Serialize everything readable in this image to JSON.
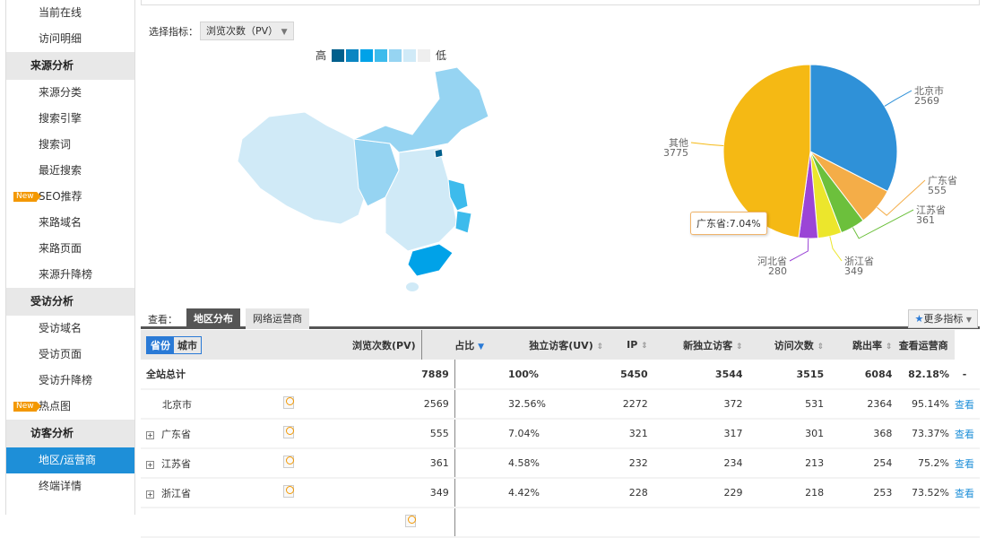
{
  "sidebar": {
    "items": [
      {
        "type": "item",
        "label": "当前在线"
      },
      {
        "type": "item",
        "label": "访问明细"
      },
      {
        "type": "head",
        "label": "来源分析"
      },
      {
        "type": "item",
        "label": "来源分类"
      },
      {
        "type": "item",
        "label": "搜索引擎"
      },
      {
        "type": "item",
        "label": "搜索词"
      },
      {
        "type": "item",
        "label": "最近搜索"
      },
      {
        "type": "item",
        "label": "SEO推荐",
        "badge": "New"
      },
      {
        "type": "item",
        "label": "来路域名"
      },
      {
        "type": "item",
        "label": "来路页面"
      },
      {
        "type": "item",
        "label": "来源升降榜"
      },
      {
        "type": "head",
        "label": "受访分析"
      },
      {
        "type": "item",
        "label": "受访域名"
      },
      {
        "type": "item",
        "label": "受访页面"
      },
      {
        "type": "item",
        "label": "受访升降榜"
      },
      {
        "type": "item",
        "label": "热点图",
        "badge": "New"
      },
      {
        "type": "head",
        "label": "访客分析"
      },
      {
        "type": "item",
        "label": "地区/运营商",
        "active": true
      },
      {
        "type": "item",
        "label": "终端详情"
      }
    ]
  },
  "metric": {
    "label": "选择指标：",
    "value": "浏览次数（PV）"
  },
  "legend": {
    "high": "高",
    "low": "低",
    "colors": [
      "#005f8c",
      "#0a86c2",
      "#00a2e8",
      "#3dbbec",
      "#96d4f2",
      "#d0eaf7",
      "#eeeeee"
    ]
  },
  "chart_data": {
    "type": "pie",
    "title": "",
    "slices": [
      {
        "name": "北京市",
        "value": 2569,
        "color": "#2f91d8"
      },
      {
        "name": "广东省",
        "value": 555,
        "color": "#f4ad48"
      },
      {
        "name": "江苏省",
        "value": 361,
        "color": "#6cc03c"
      },
      {
        "name": "浙江省",
        "value": 349,
        "color": "#ece62c"
      },
      {
        "name": "河北省",
        "value": 280,
        "color": "#9b45d6"
      },
      {
        "name": "其他",
        "value": 3775,
        "color": "#f5b914"
      }
    ],
    "tooltip": "广东省:7.04%"
  },
  "tabs": {
    "label": "查看：",
    "items": [
      "地区分布",
      "网络运营商"
    ],
    "more": "更多指标"
  },
  "table": {
    "toggle": [
      "省份",
      "城市"
    ],
    "headers": [
      "浏览次数(PV)",
      "占比",
      "独立访客(UV)",
      "IP",
      "新独立访客",
      "访问次数",
      "跳出率",
      "查看运营商"
    ],
    "total": {
      "name": "全站总计",
      "pv": "7889",
      "pct": "100%",
      "uv": "5450",
      "ip": "3544",
      "nuv": "3515",
      "visits": "6084",
      "bounce": "82.18%",
      "op": "-"
    },
    "rows": [
      {
        "name": "北京市",
        "expand": false,
        "pv": "2569",
        "pct": "32.56%",
        "uv": "2272",
        "ip": "372",
        "nuv": "531",
        "visits": "2364",
        "bounce": "95.14%",
        "op": "查看"
      },
      {
        "name": "广东省",
        "expand": true,
        "pv": "555",
        "pct": "7.04%",
        "uv": "321",
        "ip": "317",
        "nuv": "301",
        "visits": "368",
        "bounce": "73.37%",
        "op": "查看"
      },
      {
        "name": "江苏省",
        "expand": true,
        "pv": "361",
        "pct": "4.58%",
        "uv": "232",
        "ip": "234",
        "nuv": "213",
        "visits": "254",
        "bounce": "75.2%",
        "op": "查看"
      },
      {
        "name": "浙江省",
        "expand": true,
        "pv": "349",
        "pct": "4.42%",
        "uv": "228",
        "ip": "229",
        "nuv": "218",
        "visits": "253",
        "bounce": "73.52%",
        "op": "查看"
      }
    ]
  }
}
